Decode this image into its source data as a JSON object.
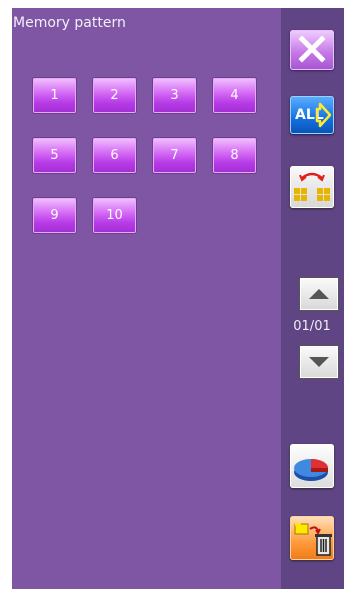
{
  "header": {
    "title": "Memory pattern"
  },
  "patterns": [
    "1",
    "2",
    "3",
    "4",
    "5",
    "6",
    "7",
    "8",
    "9",
    "10"
  ],
  "sidebar": {
    "close_icon": "close-icon",
    "all_label": "ALL",
    "swap_icon": "swap-icon",
    "page_indicator": "01/01",
    "pie_icon": "pie-chart-icon",
    "delete_icon": "delete-to-trash-icon"
  },
  "colors": {
    "panel": "#7e56a3",
    "sidebar": "#5f4584",
    "pattern_button": "#c456ef"
  }
}
